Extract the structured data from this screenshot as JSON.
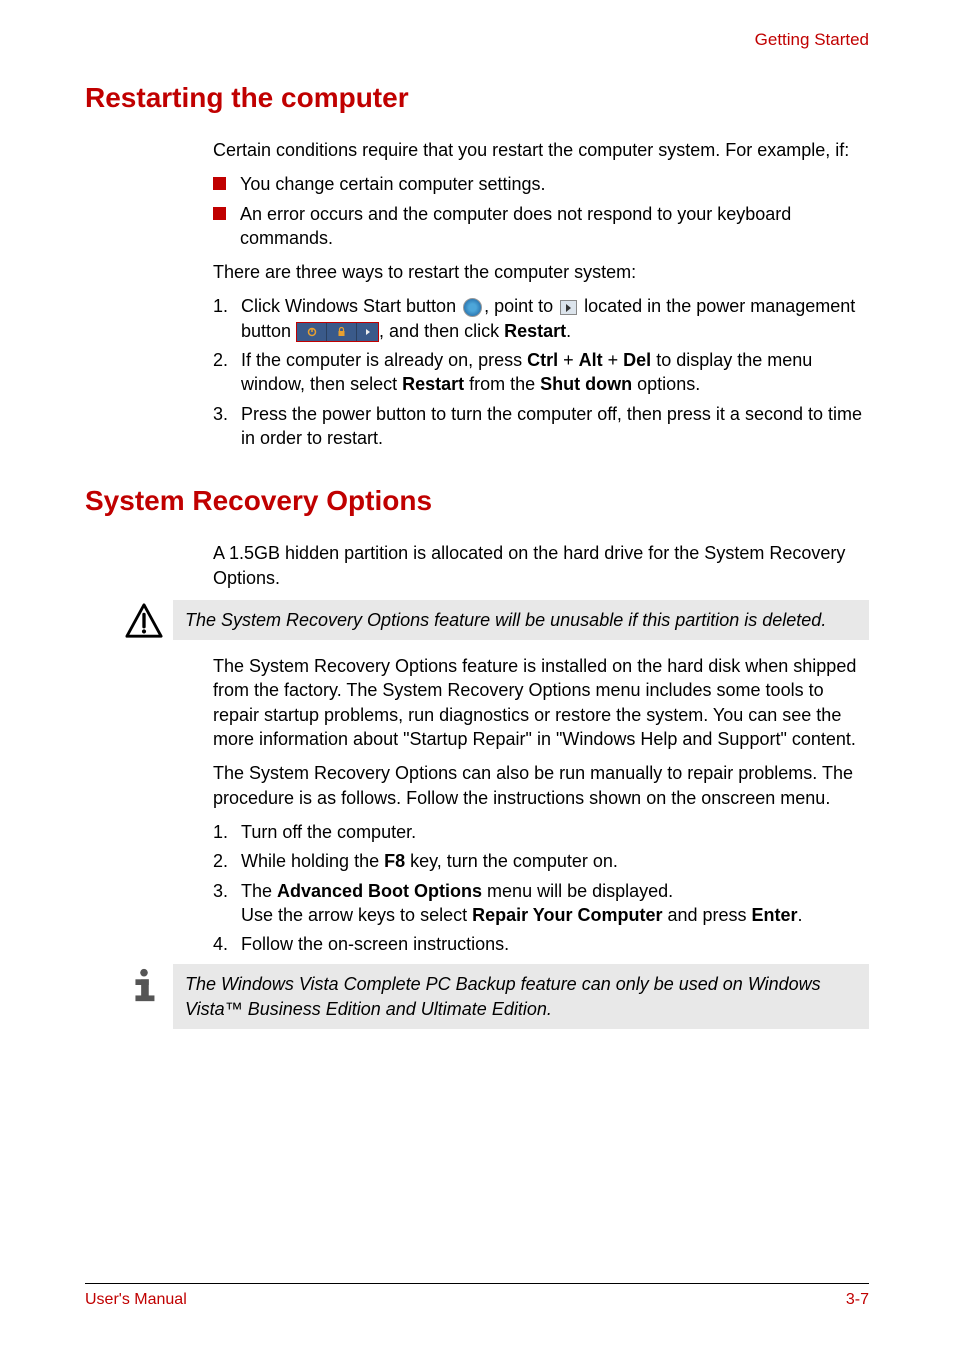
{
  "header": {
    "section_label": "Getting Started"
  },
  "h1_restart": "Restarting the computer",
  "restart": {
    "intro": "Certain conditions require that you restart the computer system. For example, if:",
    "bullets": [
      "You change certain computer settings.",
      "An error occurs and the computer does not respond to your keyboard commands."
    ],
    "three_ways": "There are three ways to restart the computer system:",
    "steps": [
      {
        "num": "1.",
        "pre": "Click Windows Start button ",
        "mid1": ", point to ",
        "mid2": " located in the power management button ",
        "post": ", and then click ",
        "bold": "Restart",
        "tail": "."
      },
      {
        "num": "2.",
        "pre": "If the computer is already on, press ",
        "b1": "Ctrl",
        "plus1": " + ",
        "b2": "Alt",
        "plus2": " + ",
        "b3": "Del",
        "mid": " to display the menu window, then select ",
        "b4": "Restart",
        "mid2": " from the ",
        "b5": "Shut down",
        "tail": " options."
      },
      {
        "num": "3.",
        "text": "Press the power button to turn the computer off, then press it a second to time in order to restart."
      }
    ]
  },
  "h1_recovery": "System Recovery Options",
  "recovery": {
    "intro": "A 1.5GB hidden partition is allocated on the hard drive for the System Recovery Options.",
    "warning": "The System Recovery Options feature will be unusable if this partition is deleted.",
    "p1": "The System Recovery Options feature is installed on the hard disk when shipped from the factory. The System Recovery Options menu includes some tools to repair startup problems, run diagnostics or restore the system. You can see the more information about \"Startup Repair\" in \"Windows Help and Support\" content.",
    "p2": "The System Recovery Options can also be run manually to repair problems. The procedure is as follows. Follow the instructions shown on the onscreen menu.",
    "steps": [
      {
        "num": "1.",
        "text": "Turn off the computer."
      },
      {
        "num": "2.",
        "pre": "While holding the ",
        "b1": "F8",
        "post": " key, turn the computer on."
      },
      {
        "num": "3.",
        "pre": "The ",
        "b1": "Advanced Boot Options",
        "mid1": " menu will be displayed.",
        "line2a": "Use the arrow keys to select ",
        "b2": "Repair Your Computer",
        "line2b": " and press ",
        "b3": "Enter",
        "tail": "."
      },
      {
        "num": "4.",
        "text": "Follow the on-screen instructions."
      }
    ],
    "info": "The Windows Vista Complete PC Backup feature can only be used on Windows Vista™ Business Edition and Ultimate Edition."
  },
  "footer": {
    "left": "User's Manual",
    "right": "3-7"
  }
}
